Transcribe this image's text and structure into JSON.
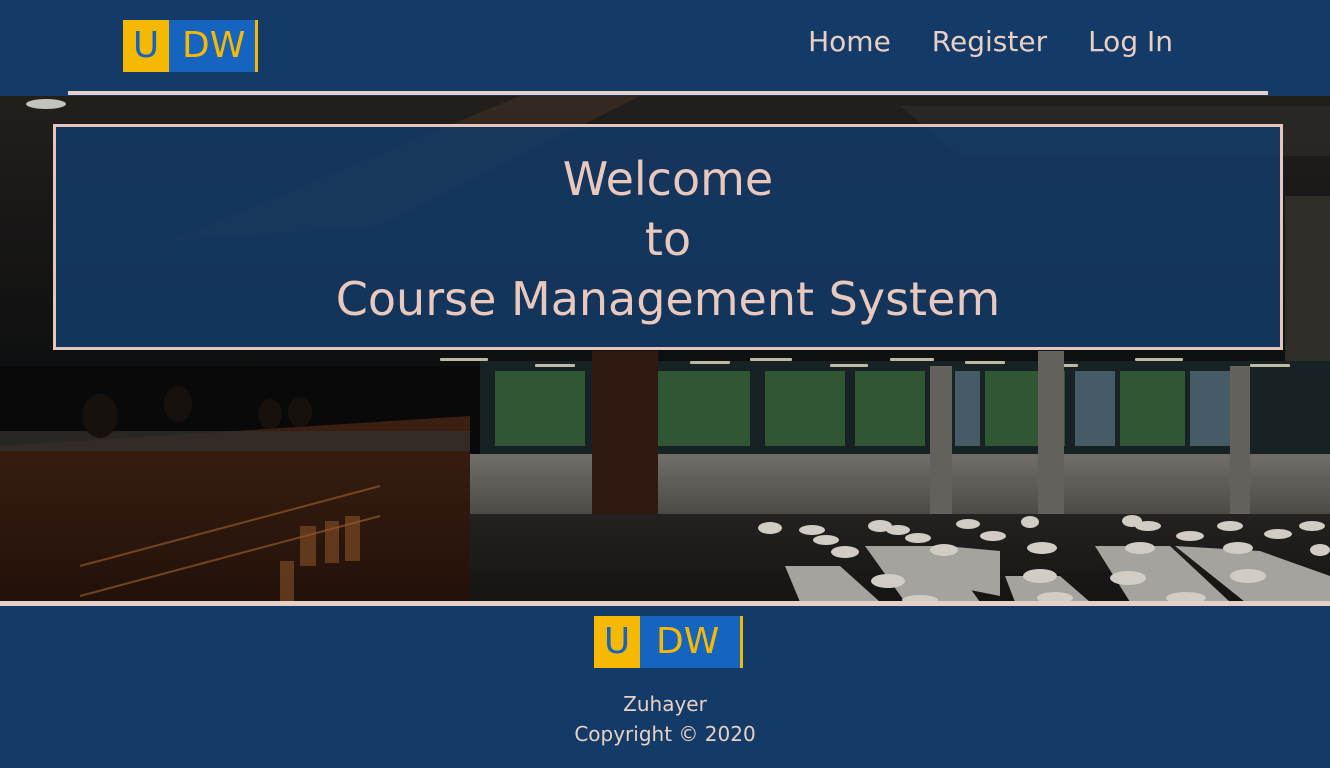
{
  "header": {
    "logo": {
      "letter_u": "U",
      "letters_dw": "DW"
    },
    "nav": [
      {
        "label": "Home"
      },
      {
        "label": "Register"
      },
      {
        "label": "Log In"
      }
    ]
  },
  "hero": {
    "line1": "Welcome",
    "line2": "to",
    "line3": "Course Management System"
  },
  "footer": {
    "logo": {
      "letter_u": "U",
      "letters_dw": "DW"
    },
    "name": "Zuhayer",
    "copyright": "Copyright © 2020"
  },
  "colors": {
    "brand_navy": "#143a68",
    "accent_peach": "#e6cfc4",
    "logo_yellow": "#f6b800",
    "logo_blue": "#1565c0"
  },
  "icons": {
    "hero_background": "library-interior-photo"
  }
}
